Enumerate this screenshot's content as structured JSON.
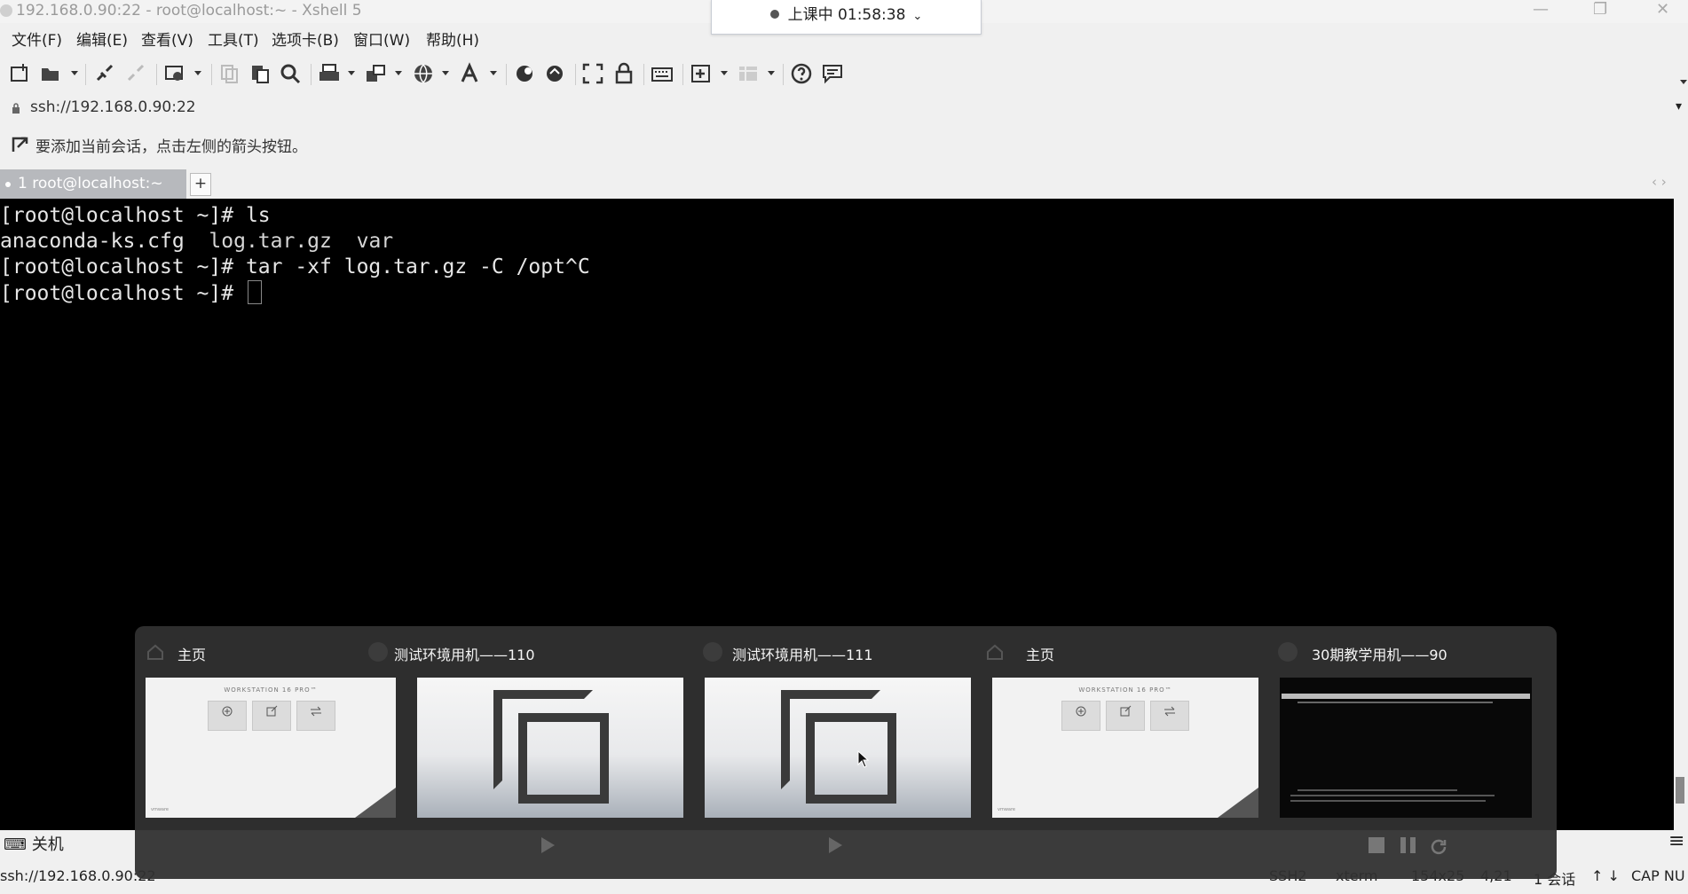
{
  "window": {
    "title": "192.168.0.90:22 - root@localhost:~ - Xshell 5",
    "minimize": "—",
    "restore": "❐",
    "close": "✕"
  },
  "session_timer": {
    "label": "上课中 01:58:38",
    "chevron": "⌄"
  },
  "menu": {
    "items": [
      "文件(F)",
      "编辑(E)",
      "查看(V)",
      "工具(T)",
      "选项卡(B)",
      "窗口(W)",
      "帮助(H)"
    ]
  },
  "address": {
    "icon": "lock-icon",
    "value": "ssh://192.168.0.90:22",
    "dropdown": "▾"
  },
  "hint": {
    "text": "要添加当前会话，点击左侧的箭头按钮。"
  },
  "tabs": [
    {
      "label": "1 root@localhost:~"
    }
  ],
  "tab_add": "+",
  "tab_nav": "‹ ›",
  "terminal": {
    "line1": "[root@localhost ~]# ls",
    "line2_a": "anaconda-ks.cfg  ",
    "line2_b": "log.tar.gz",
    "line2_c": "  ",
    "line2_d": "var",
    "line3": "[root@localhost ~]# tar -xf log.tar.gz -C /opt^C",
    "line4": "[root@localhost ~]# "
  },
  "status": {
    "left": "关机",
    "menu_icon": "≡"
  },
  "bottombar": {
    "address": "ssh://192.168.0.90:22",
    "protocol": "SSH2",
    "term": "xterm",
    "size": "154x25",
    "pos": "4,21",
    "sessions": "1 会话",
    "caps": "CAP NU"
  },
  "task_switcher": {
    "cards": [
      {
        "title": "主页",
        "icon": "home-icon",
        "thumb": "workstation-home"
      },
      {
        "title": "测试环境用机——110",
        "icon": "vm-icon",
        "thumb": "vm-logo"
      },
      {
        "title": "测试环境用机——111",
        "icon": "vm-icon",
        "thumb": "vm-logo"
      },
      {
        "title": "主页",
        "icon": "home-icon",
        "thumb": "workstation-home"
      },
      {
        "title": "30期教学用机——90",
        "icon": "vm-icon",
        "thumb": "grub-screen"
      }
    ],
    "workstation_heading": "WORKSTATION 16 PRO™",
    "controls": [
      "stop-icon",
      "pause-icon",
      "refresh-icon"
    ]
  },
  "colors": {
    "terminal_bg": "#000000",
    "terminal_fg": "#e6e6e6",
    "panel_bg": "#303030",
    "tab_active": "#b7b9bd"
  }
}
